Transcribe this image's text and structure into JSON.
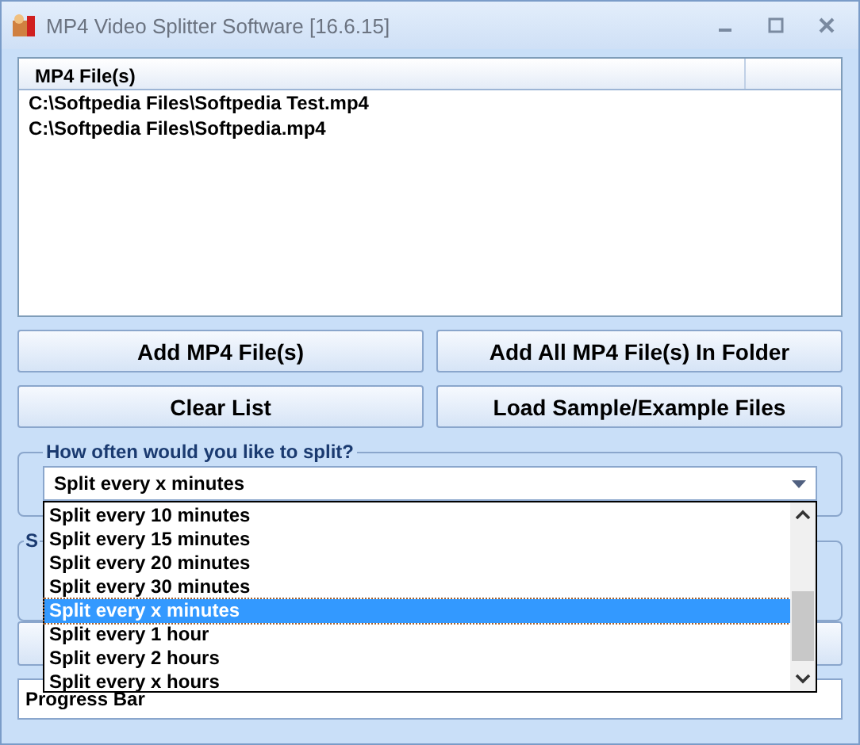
{
  "window": {
    "title": "MP4 Video Splitter Software [16.6.15]"
  },
  "file_list": {
    "columns": [
      "MP4 File(s)"
    ],
    "rows": [
      "C:\\Softpedia Files\\Softpedia Test.mp4",
      "C:\\Softpedia Files\\Softpedia.mp4"
    ]
  },
  "buttons": [
    "Add MP4 File(s)",
    "Add All MP4 File(s) In Folder",
    "Clear List",
    "Load Sample/Example Files"
  ],
  "split_group": {
    "label": "How often would you like to split?",
    "value": "Split every x minutes",
    "options": [
      {
        "label": "Split every 10 minutes",
        "selected": false
      },
      {
        "label": "Split every 15 minutes",
        "selected": false
      },
      {
        "label": "Split every 20 minutes",
        "selected": false
      },
      {
        "label": "Split every 30 minutes",
        "selected": false
      },
      {
        "label": "Split every x minutes",
        "selected": true
      },
      {
        "label": "Split every 1 hour",
        "selected": false
      },
      {
        "label": "Split every 2 hours",
        "selected": false
      },
      {
        "label": "Split every x hours",
        "selected": false
      }
    ]
  },
  "second_group": {
    "label": "S"
  },
  "progress_bar": {
    "label": "Progress Bar",
    "level": 0
  }
}
